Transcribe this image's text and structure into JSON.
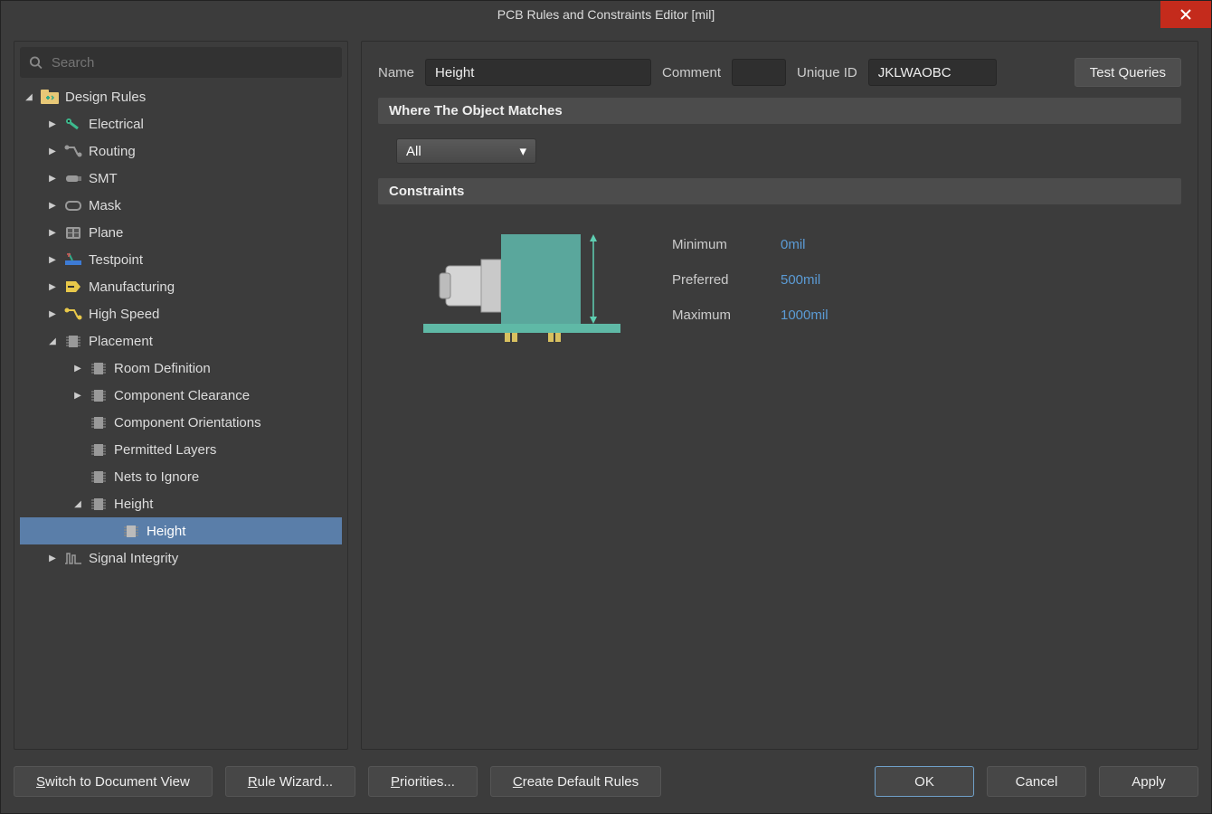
{
  "title": "PCB Rules and Constraints Editor [mil]",
  "search": {
    "placeholder": "Search"
  },
  "tree": {
    "root": "Design Rules",
    "electrical": "Electrical",
    "routing": "Routing",
    "smt": "SMT",
    "mask": "Mask",
    "plane": "Plane",
    "testpoint": "Testpoint",
    "manufacturing": "Manufacturing",
    "highspeed": "High Speed",
    "placement": "Placement",
    "placement_items": {
      "room": "Room Definition",
      "clearance": "Component Clearance",
      "orient": "Component Orientations",
      "layers": "Permitted Layers",
      "nets": "Nets to Ignore",
      "height": "Height",
      "height_rule": "Height"
    },
    "signal": "Signal Integrity"
  },
  "form": {
    "name_label": "Name",
    "name_value": "Height",
    "comment_label": "Comment",
    "comment_value": "",
    "uid_label": "Unique ID",
    "uid_value": "JKLWAOBC",
    "test_queries": "Test Queries",
    "where_header": "Where The Object Matches",
    "scope": "All",
    "constraints_header": "Constraints",
    "min_label": "Minimum",
    "min_value": "0mil",
    "pref_label": "Preferred",
    "pref_value": "500mil",
    "max_label": "Maximum",
    "max_value": "1000mil"
  },
  "footer": {
    "switch": "Switch to Document View",
    "wizard": "Rule Wizard...",
    "priorities": "Priorities...",
    "create_default": "Create Default Rules",
    "ok": "OK",
    "cancel": "Cancel",
    "apply": "Apply"
  }
}
